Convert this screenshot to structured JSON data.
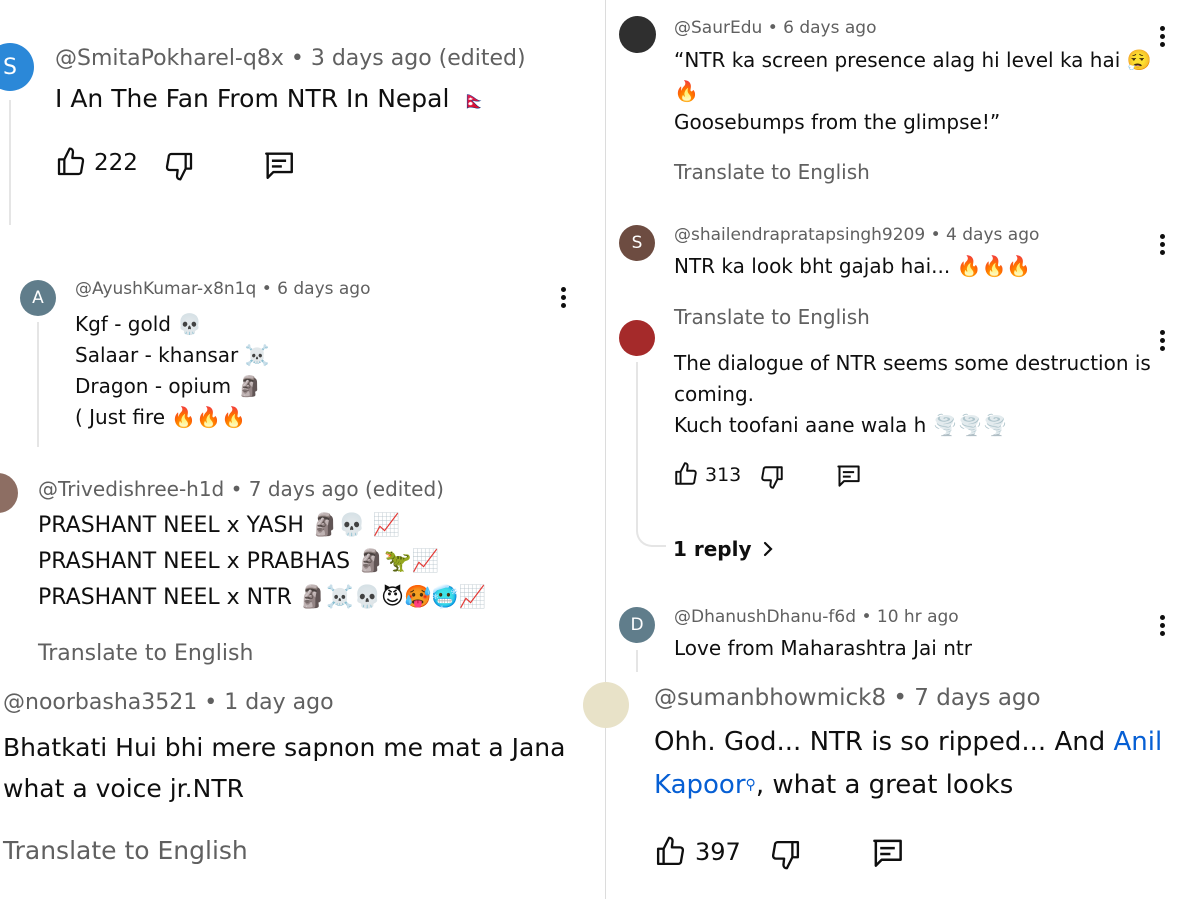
{
  "left": {
    "c1": {
      "avatar_letter": "S",
      "author": "@SmitaPokharel-q8x",
      "time": "3 days ago (edited)",
      "text": "I An The Fan From NTR In Nepal",
      "flag": "🇳🇵",
      "likes": "222"
    },
    "c2": {
      "avatar_letter": "A",
      "author": "@AyushKumar-x8n1q",
      "time": "6 days ago",
      "lines": [
        "Kgf - gold 💀",
        "Salaar - khansar ☠️",
        "Dragon - opium 🗿",
        "( Just fire 🔥🔥🔥"
      ]
    },
    "c3": {
      "author": "@Trivedishree-h1d",
      "time": "7 days ago (edited)",
      "lines": [
        "PRASHANT NEEL x YASH 🗿💀 📈",
        "PRASHANT NEEL x PRABHAS 🗿🦖📈",
        "PRASHANT NEEL x NTR 🗿☠️💀😈🥵🥶📈"
      ],
      "translate": "Translate to English"
    },
    "c4": {
      "author": "@noorbasha3521",
      "time": "1 day ago",
      "lines": [
        "Bhatkati Hui bhi mere sapnon me mat a Jana",
        "what a voice jr.NTR"
      ],
      "translate": "Translate to English"
    }
  },
  "right": {
    "c1": {
      "author": "@SaurEdu",
      "time": "6 days ago",
      "lines": [
        "“NTR ka screen presence alag hi level ka hai 😮‍💨",
        "🔥",
        "Goosebumps from the glimpse!”"
      ],
      "translate": "Translate to English"
    },
    "c2": {
      "avatar_letter": "S",
      "author": "@shailendrapratapsingh9209",
      "time": "4 days ago",
      "text": "NTR ka look bht gajab hai... 🔥🔥🔥",
      "translate": "Translate to English"
    },
    "c3": {
      "lines": [
        "The dialogue of NTR seems some destruction is",
        "coming.",
        "Kuch toofani aane wala h 🌪️🌪️🌪️"
      ],
      "likes": "313",
      "reply": "1 reply"
    },
    "c4": {
      "avatar_letter": "D",
      "author": "@DhanushDhanu-f6d",
      "time": "10 hr ago",
      "text": "Love from Maharashtra Jai ntr"
    },
    "c5": {
      "author": "@sumanbhowmick8",
      "time": "7 days ago",
      "text_a": "Ohh. God... NTR is so ripped... And",
      "link_a": "Anil",
      "link_b": "Kapoor",
      "text_b": ", what a great looks",
      "likes": "397"
    }
  },
  "colors": {
    "avatar_blue": "#2b88d8",
    "avatar_slate": "#607d8b",
    "avatar_brown": "#6d4c41",
    "link": "#065fd4",
    "meta": "#606060"
  }
}
